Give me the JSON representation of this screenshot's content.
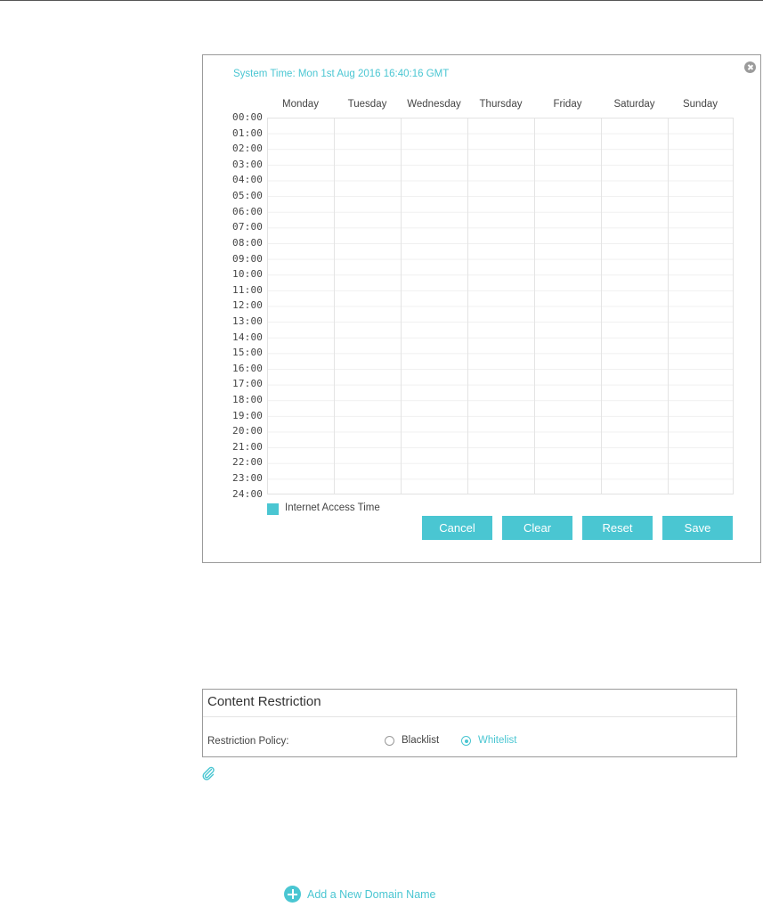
{
  "schedule": {
    "system_time": "System Time: Mon 1st Aug 2016 16:40:16 GMT",
    "days": [
      "Monday",
      "Tuesday",
      "Wednesday",
      "Thursday",
      "Friday",
      "Saturday",
      "Sunday"
    ],
    "hours": [
      "00:00",
      "01:00",
      "02:00",
      "03:00",
      "04:00",
      "05:00",
      "06:00",
      "07:00",
      "08:00",
      "09:00",
      "10:00",
      "11:00",
      "12:00",
      "13:00",
      "14:00",
      "15:00",
      "16:00",
      "17:00",
      "18:00",
      "19:00",
      "20:00",
      "21:00",
      "22:00",
      "23:00",
      "24:00"
    ],
    "legend_label": "Internet Access Time",
    "buttons": {
      "cancel": "Cancel",
      "clear": "Clear",
      "reset": "Reset",
      "save": "Save"
    },
    "close_icon": "close-icon"
  },
  "content_restriction": {
    "title": "Content Restriction",
    "policy_label": "Restriction Policy:",
    "options": {
      "blacklist": "Blacklist",
      "whitelist": "Whitelist"
    },
    "selected": "Whitelist"
  },
  "note_icon": "paperclip-icon",
  "add_domain": {
    "label": "Add a New Domain Name",
    "icon": "plus-circle-icon"
  },
  "colors": {
    "accent": "#4ac6d2",
    "border": "#9a9a9a",
    "grid_line": "#e4e4e4"
  }
}
